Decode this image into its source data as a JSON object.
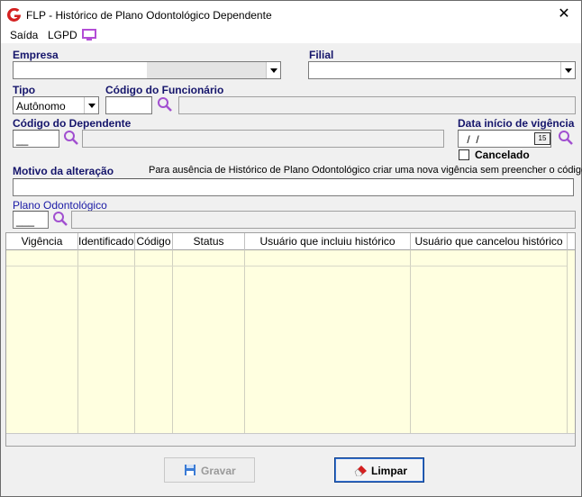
{
  "window": {
    "title": "FLP - Histórico de Plano Odontológico Dependente",
    "close_label": "✕"
  },
  "menu": {
    "items": [
      "Saída",
      "LGPD"
    ],
    "monitor_icon": "monitor-icon",
    "accent_color": "#b34dd6"
  },
  "form": {
    "empresa_label": "Empresa",
    "empresa_value": "",
    "filial_label": "Filial",
    "filial_value": "",
    "tipo_label": "Tipo",
    "tipo_value": "Autônomo",
    "codigo_funcionario_label": "Código do Funcionário",
    "codigo_funcionario_value": "",
    "funcionario_nome_value": "",
    "codigo_dependente_label": "Código do Dependente",
    "codigo_dependente_value": "__",
    "dependente_nome_value": "",
    "data_inicio_label": "Data início de vigência",
    "data_inicio_value": " /  /",
    "calendar_label": "15",
    "cancelado_label": "Cancelado",
    "cancelado_checked": false,
    "motivo_label": "Motivo da alteração",
    "motivo_hint": "Para ausência de Histórico de Plano Odontológico criar uma nova vigência sem preencher o código",
    "motivo_value": "",
    "plano_label": "Plano Odontológico",
    "plano_value": "___",
    "plano_nome_value": ""
  },
  "grid": {
    "columns": [
      "Vigência",
      "Identificador",
      "Código",
      "Status",
      "Usuário que incluiu histórico",
      "Usuário que cancelou histórico"
    ],
    "rows": [],
    "background": "#ffffe0"
  },
  "buttons": {
    "gravar_label": "Gravar",
    "limpar_label": "Limpar"
  },
  "colors": {
    "label_blue": "#15156b",
    "search_icon": "#a14fd0",
    "brand_red": "#d42020"
  }
}
